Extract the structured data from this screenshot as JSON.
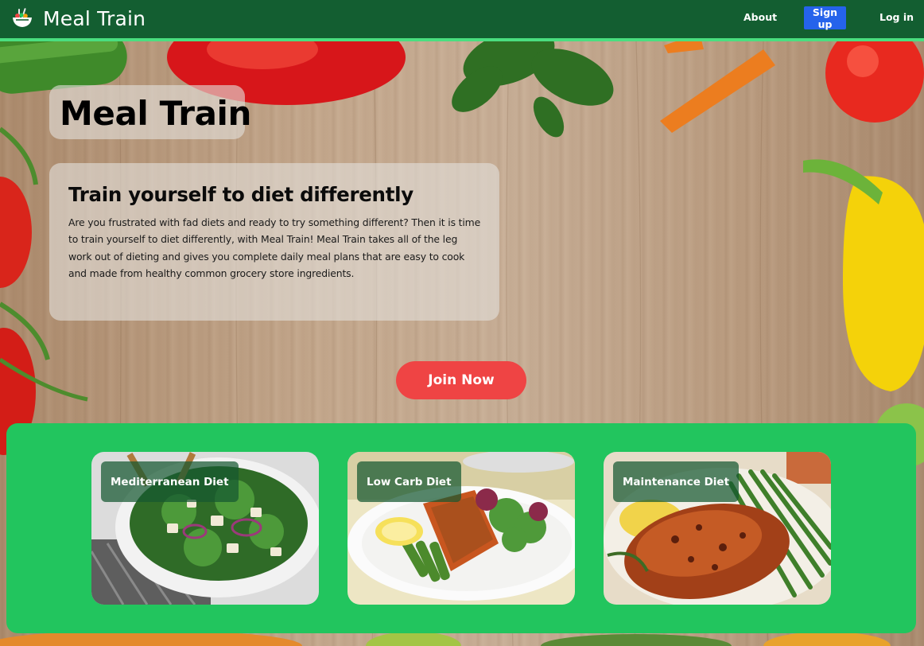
{
  "nav": {
    "brand": "Meal Train",
    "about": "About",
    "signup": "Sign up",
    "login": "Log in"
  },
  "hero": {
    "title": "Meal Train",
    "heading": "Train yourself to diet differently",
    "description": "Are you frustrated with fad diets and ready to try something different? Then it is time to train yourself to diet differently, with Meal Train! Meal Train takes all of the leg work out of dieting and gives you complete daily meal plans that are easy to cook and made from healthy common grocery store ingredients.",
    "cta": "Join Now"
  },
  "diets": [
    {
      "label": "Mediterranean Diet",
      "image": "salad-bowl"
    },
    {
      "label": "Low Carb Diet",
      "image": "salmon-plate"
    },
    {
      "label": "Maintenance Diet",
      "image": "chicken-plate"
    }
  ],
  "colors": {
    "navbar": "#135e31",
    "navbar_border": "#4ade80",
    "signup": "#2563eb",
    "cta": "#ef4444",
    "panel": "#22c55e"
  }
}
